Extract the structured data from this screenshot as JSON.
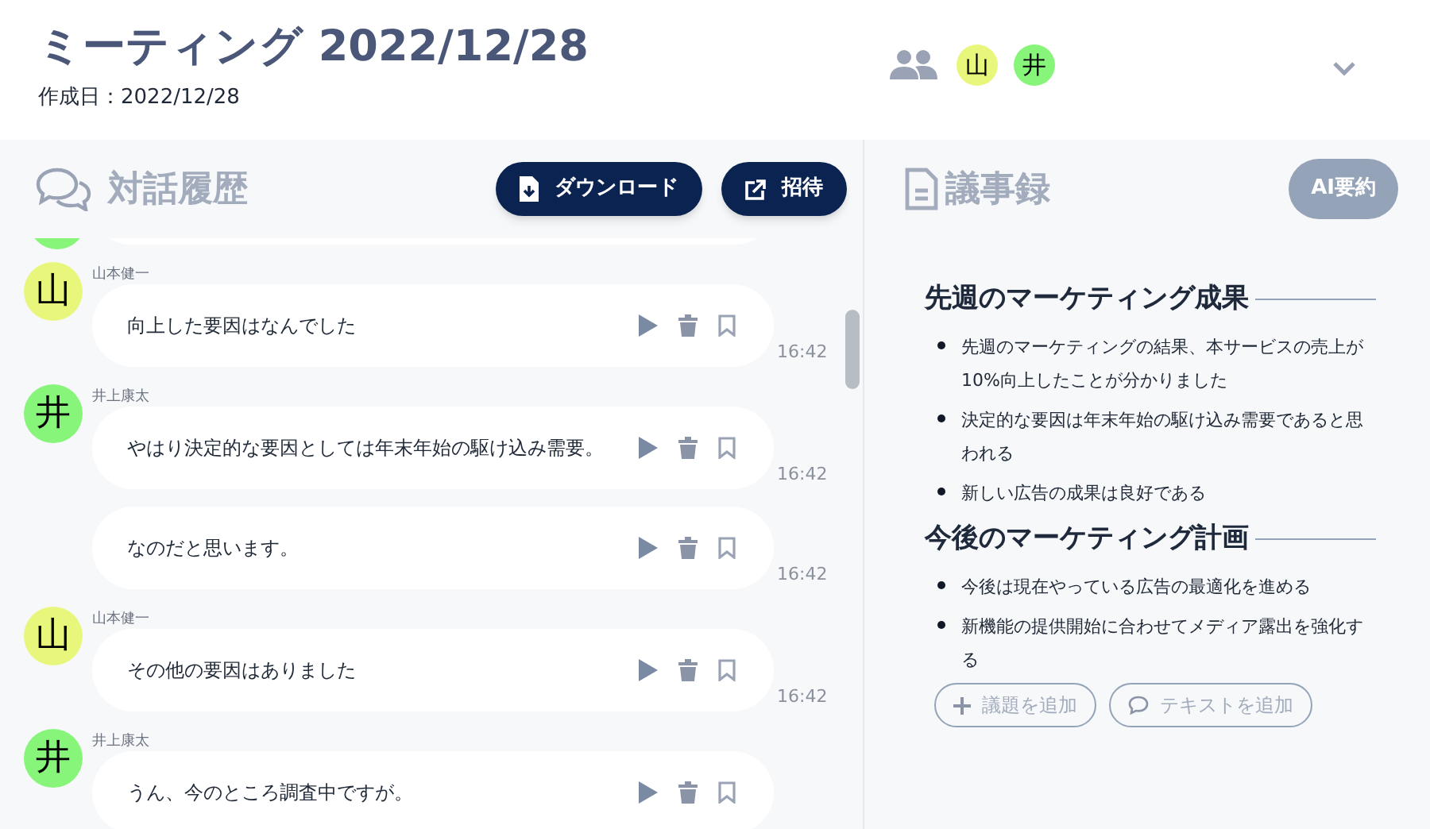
{
  "meeting": {
    "title": "ミーティング 2022/12/28",
    "created": "作成日：2022/12/28",
    "participants": [
      {
        "initial": "山",
        "color": "#e8f77c"
      },
      {
        "initial": "井",
        "color": "#86f57a"
      }
    ]
  },
  "chat": {
    "title": "対話履歴",
    "buttons": [
      {
        "kind": "download",
        "label": "ダウンロード"
      },
      {
        "kind": "invite",
        "label": "招待"
      }
    ],
    "messages": [
      {
        "kind": "clipped",
        "color": "#86f57a"
      },
      {
        "kind": "named",
        "speaker": "山本健一",
        "initial": "山",
        "color": "#e8f77c",
        "text": "向上した要因はなんでした",
        "time": "16:42"
      },
      {
        "kind": "named",
        "speaker": "井上康太",
        "initial": "井",
        "color": "#86f57a",
        "text": "やはり決定的な要因としては年末年始の駆け込み需要。",
        "time": "16:42"
      },
      {
        "kind": "continued",
        "text": "なのだと思います。",
        "time": "16:42"
      },
      {
        "kind": "named",
        "speaker": "山本健一",
        "initial": "山",
        "color": "#e8f77c",
        "text": "その他の要因はありました",
        "time": "16:42"
      },
      {
        "kind": "named",
        "speaker": "井上康太",
        "initial": "井",
        "color": "#86f57a",
        "text": "うん、今のところ調査中ですが。"
      }
    ]
  },
  "minutes": {
    "title": "議事録",
    "summary_button": {
      "label": "AI要約",
      "disabled": true
    },
    "sections": [
      {
        "heading": "先週のマーケティング成果",
        "items": [
          "先週のマーケティングの結果、本サービスの売上が10%向上したことが分かりました",
          "決定的な要因は年末年始の駆け込み需要であると思われる",
          "新しい広告の成果は良好である"
        ]
      },
      {
        "heading": "今後のマーケティング計画",
        "items": [
          "今後は現在やっている広告の最適化を進める",
          "新機能の提供開始に合わせてメディア露出を強化する"
        ]
      }
    ],
    "actions": [
      {
        "kind": "topic",
        "label": "議題を追加"
      },
      {
        "kind": "text",
        "label": "テキストを追加"
      }
    ]
  }
}
